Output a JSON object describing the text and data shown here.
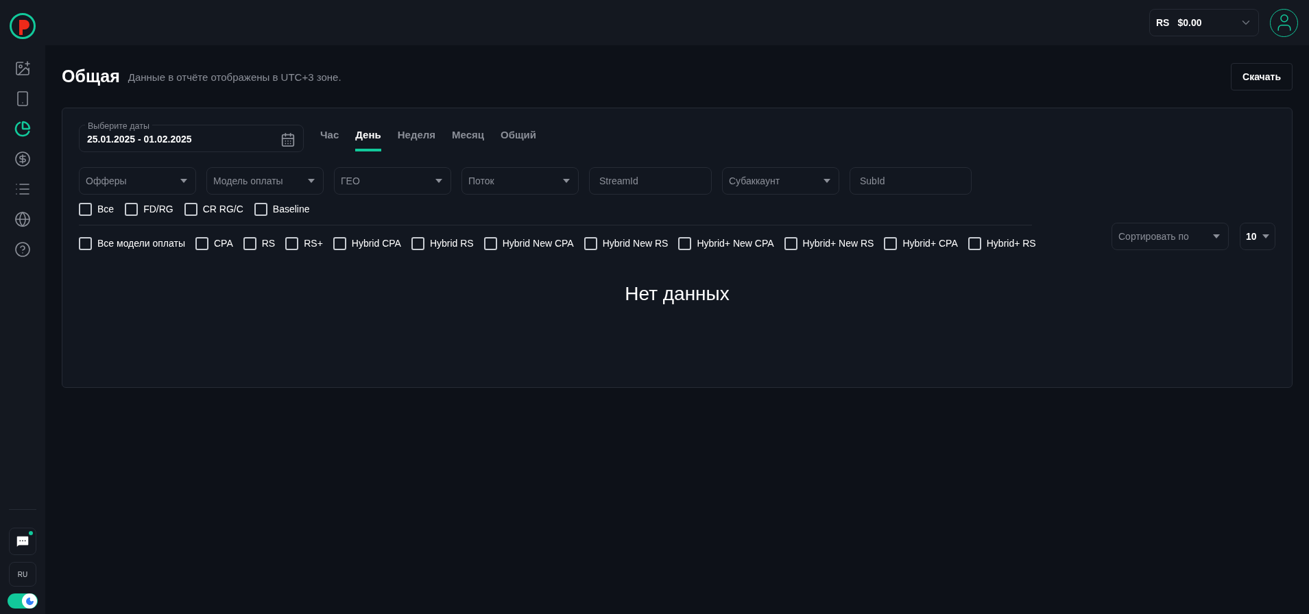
{
  "sidebar": {
    "items": [
      {
        "kind": "image-add",
        "selected": false
      },
      {
        "kind": "phone",
        "selected": false
      },
      {
        "kind": "pie",
        "selected": true
      },
      {
        "kind": "dollar",
        "selected": false
      },
      {
        "kind": "list",
        "selected": false
      },
      {
        "kind": "news",
        "selected": false
      },
      {
        "kind": "help",
        "selected": false
      }
    ],
    "chat": {
      "unread": true
    },
    "language": "RU",
    "dark_mode": {
      "on": true
    }
  },
  "header": {
    "currency": "RS",
    "balance": "$0.00"
  },
  "page": {
    "title": "Общая",
    "subtitle": "Данные в отчёте отображены в UTC+3 зоне.",
    "download_button": "Скачать"
  },
  "date_field": {
    "label": "Выберите даты",
    "value": "25.01.2025 - 01.02.2025"
  },
  "period_tabs": [
    {
      "label": "Час",
      "selected": false
    },
    {
      "label": "День",
      "selected": true
    },
    {
      "label": "Неделя",
      "selected": false
    },
    {
      "label": "Месяц",
      "selected": false
    },
    {
      "label": "Общий",
      "selected": false
    }
  ],
  "filters": [
    {
      "kind": "select",
      "placeholder": "Офферы"
    },
    {
      "kind": "select",
      "placeholder": "Модель оплаты"
    },
    {
      "kind": "select",
      "placeholder": "ГЕО"
    },
    {
      "kind": "select",
      "placeholder": "Поток"
    },
    {
      "kind": "input",
      "placeholder": "StreamId"
    },
    {
      "kind": "select",
      "placeholder": "Субаккаунт"
    },
    {
      "kind": "input",
      "placeholder": "SubId"
    }
  ],
  "metric_checkboxes": [
    {
      "label": "Все",
      "checked": false
    },
    {
      "label": "FD/RG",
      "checked": false
    },
    {
      "label": "CR RG/C",
      "checked": false
    },
    {
      "label": "Baseline",
      "checked": false
    }
  ],
  "payment_model_checkboxes": [
    {
      "label": "Все модели оплаты",
      "checked": false
    },
    {
      "label": "CPA",
      "checked": false
    },
    {
      "label": "RS",
      "checked": false
    },
    {
      "label": "RS+",
      "checked": false
    },
    {
      "label": "Hybrid CPA",
      "checked": false
    },
    {
      "label": "Hybrid RS",
      "checked": false
    },
    {
      "label": "Hybrid New CPA",
      "checked": false
    },
    {
      "label": "Hybrid New RS",
      "checked": false
    },
    {
      "label": "Hybrid+ New CPA",
      "checked": false
    },
    {
      "label": "Hybrid+ New RS",
      "checked": false
    },
    {
      "label": "Hybrid+ CPA",
      "checked": false
    },
    {
      "label": "Hybrid+ RS",
      "checked": false
    }
  ],
  "sort": {
    "placeholder": "Сортировать по"
  },
  "page_size": "10",
  "empty_message": "Нет данных"
}
